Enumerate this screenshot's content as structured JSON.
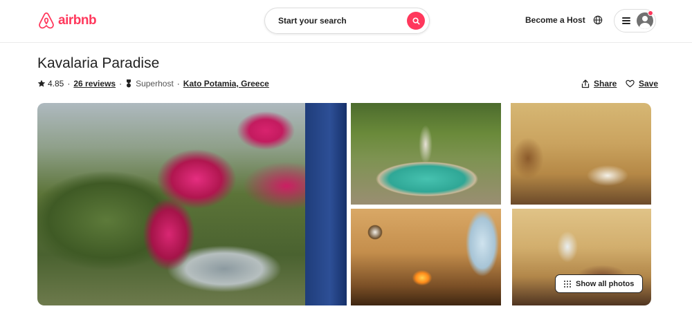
{
  "brand": {
    "name": "airbnb",
    "color": "#ff385c"
  },
  "header": {
    "search_placeholder": "Start your search",
    "host_link": "Become a Host",
    "icons": {
      "search": "search-icon",
      "globe": "globe-icon",
      "menu": "hamburger-menu-icon",
      "avatar": "user-avatar-icon"
    }
  },
  "listing": {
    "title": "Kavalaria Paradise",
    "rating": "4.85",
    "reviews": "26 reviews",
    "superhost": "Superhost",
    "location": "Kato Potamia, Greece",
    "separator": "·"
  },
  "actions": {
    "share": "Share",
    "save": "Save"
  },
  "photos": {
    "items": [
      {
        "description_label": "main-garden-bougainvillea-photo"
      },
      {
        "description_label": "pool-fountain-photo"
      },
      {
        "description_label": "bedroom-photo"
      },
      {
        "description_label": "fireplace-living-room-photo"
      },
      {
        "description_label": "bedroom-two-photo"
      }
    ],
    "show_all": "Show all photos"
  }
}
